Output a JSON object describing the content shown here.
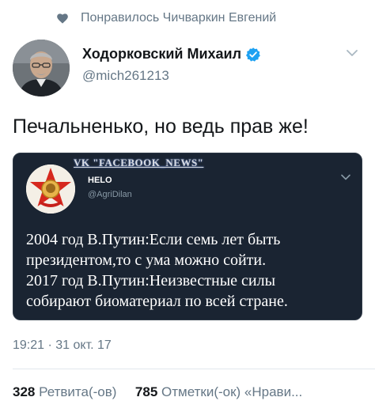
{
  "social_context": {
    "icon": "heart-icon",
    "text": "Понравилось Чичваркин Евгений"
  },
  "author": {
    "name": "Ходорковский Михаил",
    "handle": "@mich261213",
    "verified_icon": "verified-badge-icon"
  },
  "tweet": {
    "text": "Печальненько, но ведь прав же!"
  },
  "embedded_image": {
    "watermark": "VK \"FACEBOOK_NEWS\"",
    "inner_name": "HELO",
    "inner_handle": "@AgriDilan",
    "lines": [
      "2004 год В.Путин:Если семь лет быть",
      "президентом,то с ума можно сойти.",
      "2017 год В.Путин:Неизвестные силы",
      "собирают биоматериал по всей стране."
    ]
  },
  "meta": {
    "timestamp": "19:21 · 31 окт. 17"
  },
  "stats": {
    "retweets_count": "328",
    "retweets_label": "Ретвита(-ов)",
    "likes_count": "785",
    "likes_label": "Отметки(-ок) «Нрави..."
  },
  "colors": {
    "secondary": "#657786",
    "verified": "#1da1f2",
    "embed_bg": "#1a2432"
  }
}
